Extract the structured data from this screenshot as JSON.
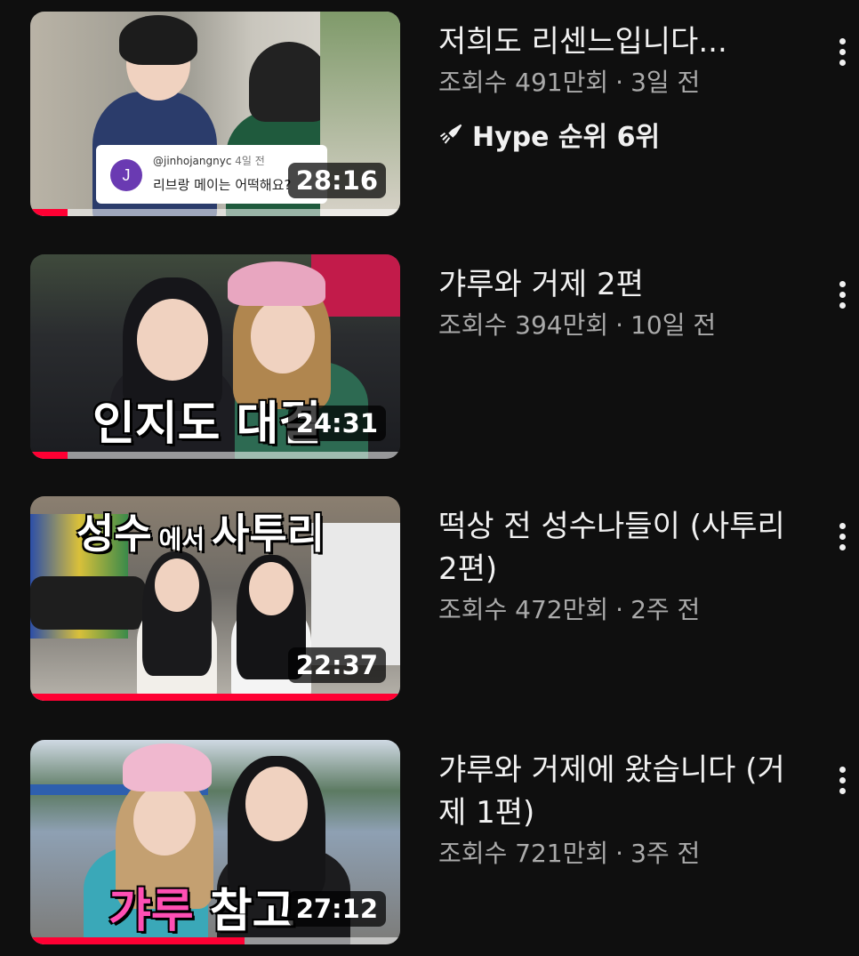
{
  "videos": [
    {
      "title": "저희도 리센느입니다...",
      "views": "조회수 491만회",
      "age": "3일 전",
      "hype": "Hype 순위 6위",
      "duration": "28:16",
      "progress": 0.1,
      "comment": {
        "avatar_letter": "J",
        "handle": "@jinhojangnyc",
        "time": "4일 전",
        "text": "리브랑 메이는 어떡해요?"
      }
    },
    {
      "title": "갸루와 거제 2편",
      "views": "조회수 394만회",
      "age": "10일 전",
      "duration": "24:31",
      "progress": 0.1,
      "overlay": "인지도 대결"
    },
    {
      "title": "떡상 전 성수나들이 (사투리2편)",
      "views": "조회수 472만회",
      "age": "2주 전",
      "duration": "22:37",
      "progress": 1.0,
      "overlay_big1": "성수",
      "overlay_small": "에서",
      "overlay_big2": "사투리"
    },
    {
      "title": "갸루와 거제에 왔습니다 (거제 1편)",
      "views": "조회수 721만회",
      "age": "3주 전",
      "duration": "27:12",
      "progress": 0.58,
      "overlay_pink": "갸루",
      "overlay_white": "참고"
    }
  ],
  "separator": "·",
  "colors": {
    "background": "#0f0f0f",
    "title": "#f1f1f1",
    "meta": "#aaaaaa",
    "progress": "#ff0033"
  },
  "icons": {
    "hype": "hype-rocket-icon",
    "menu": "more-vert-icon"
  }
}
